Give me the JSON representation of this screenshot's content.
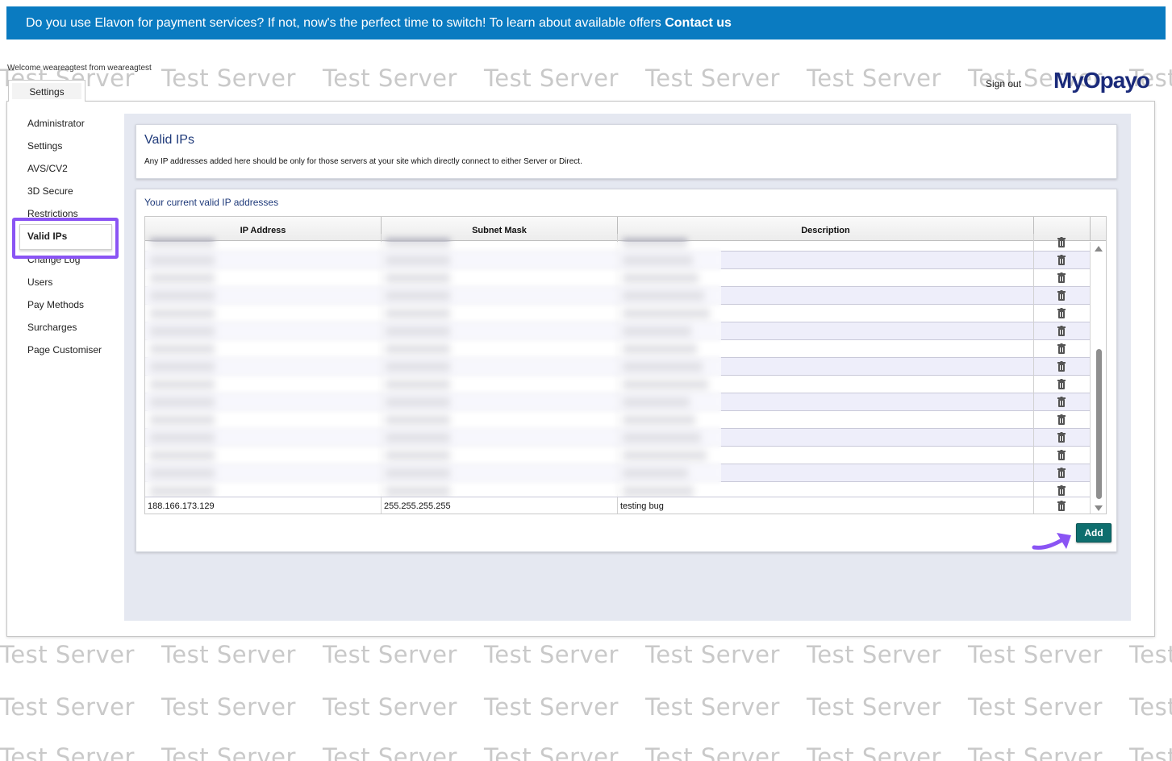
{
  "banner": {
    "text": "Do you use Elavon for payment services? If not, now's the perfect time to switch! To learn about available offers ",
    "link": "Contact us"
  },
  "header": {
    "welcome": "Welcome weareagtest from weareagtest",
    "sign_out": "Sign out",
    "logo": "MyOpayo"
  },
  "watermark": "Test Server",
  "tabs": [
    {
      "label": "Settings"
    }
  ],
  "sidebar": {
    "items": [
      {
        "label": "Administrator"
      },
      {
        "label": "Settings"
      },
      {
        "label": "AVS/CV2"
      },
      {
        "label": "3D Secure"
      },
      {
        "label": "Restrictions"
      },
      {
        "label": "Valid IPs"
      },
      {
        "label": "Change Log"
      },
      {
        "label": "Users"
      },
      {
        "label": "Pay Methods"
      },
      {
        "label": "Surcharges"
      },
      {
        "label": "Page Customiser"
      }
    ],
    "active": "Valid IPs"
  },
  "valid_ips": {
    "title": "Valid IPs",
    "description": "Any IP addresses added here should be only for those servers at your site which directly connect to either Server or Direct.",
    "list_title": "Your current valid IP addresses",
    "columns": [
      "IP Address",
      "Subnet Mask",
      "Description"
    ],
    "last_row": {
      "ip": "188.166.173.129",
      "mask": "255.255.255.255",
      "description": "testing bug"
    },
    "add_label": "Add"
  },
  "colors": {
    "banner": "#0a7bc1",
    "accent": "#8a54f4",
    "add_button": "#0e6e6e",
    "title": "#1f3a7a"
  }
}
